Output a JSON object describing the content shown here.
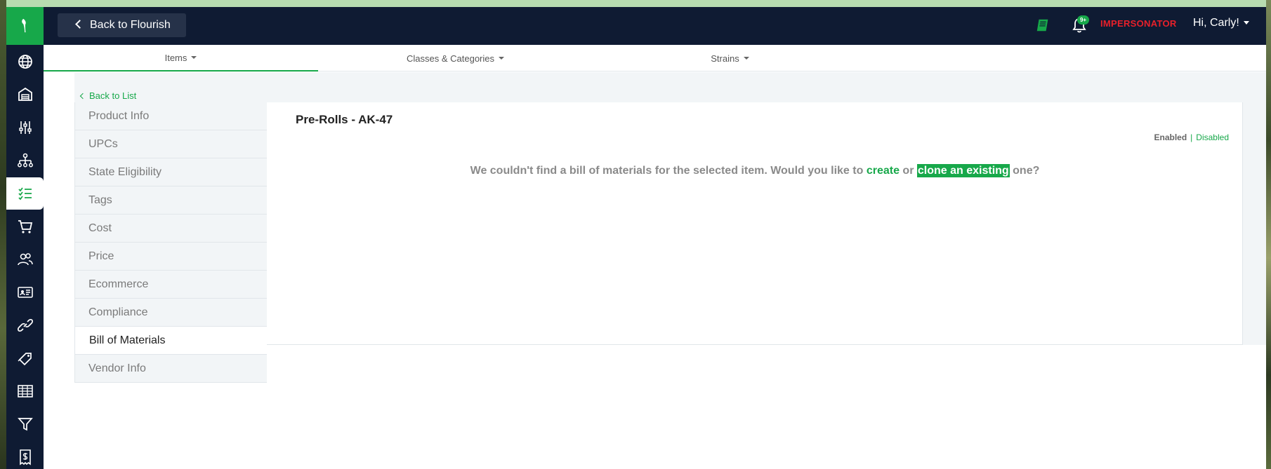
{
  "topbar": {
    "back_label": "Back to Flourish",
    "notification_badge": "9+",
    "impersonator_label": "IMPERSONATOR",
    "greeting": "Hi, Carly!"
  },
  "sidebar": {
    "icons": [
      "globe-icon",
      "warehouse-icon",
      "sliders-icon",
      "org-chart-icon",
      "list-check-icon",
      "cart-icon",
      "users-icon",
      "id-card-icon",
      "link-icon",
      "tag-icon",
      "table-icon",
      "filter-icon",
      "receipt-icon"
    ],
    "active": "list-check-icon"
  },
  "subnav": {
    "tabs": [
      {
        "label": "Items",
        "active": true
      },
      {
        "label": "Classes & Categories",
        "active": false
      },
      {
        "label": "Strains",
        "active": false
      }
    ]
  },
  "back_to_list": "Back to List",
  "item_menu": [
    {
      "label": "Product Info"
    },
    {
      "label": "UPCs"
    },
    {
      "label": "State Eligibility"
    },
    {
      "label": "Tags"
    },
    {
      "label": "Cost"
    },
    {
      "label": "Price"
    },
    {
      "label": "Ecommerce"
    },
    {
      "label": "Compliance"
    },
    {
      "label": "Bill of Materials",
      "active": true
    },
    {
      "label": "Vendor Info"
    }
  ],
  "panel": {
    "title": "Pre-Rolls - AK-47",
    "status": {
      "enabled": "Enabled",
      "separator": "|",
      "disabled": "Disabled"
    },
    "message": {
      "prefix": "We couldn't find a bill of materials for the selected item. Would you like to",
      "create_link": "create",
      "middle": "or",
      "clone_link": "clone an existing",
      "suffix": "one?"
    }
  },
  "colors": {
    "brand_green": "#17a84a",
    "navbar": "#0f1b33",
    "alert_red": "#e8202a"
  }
}
